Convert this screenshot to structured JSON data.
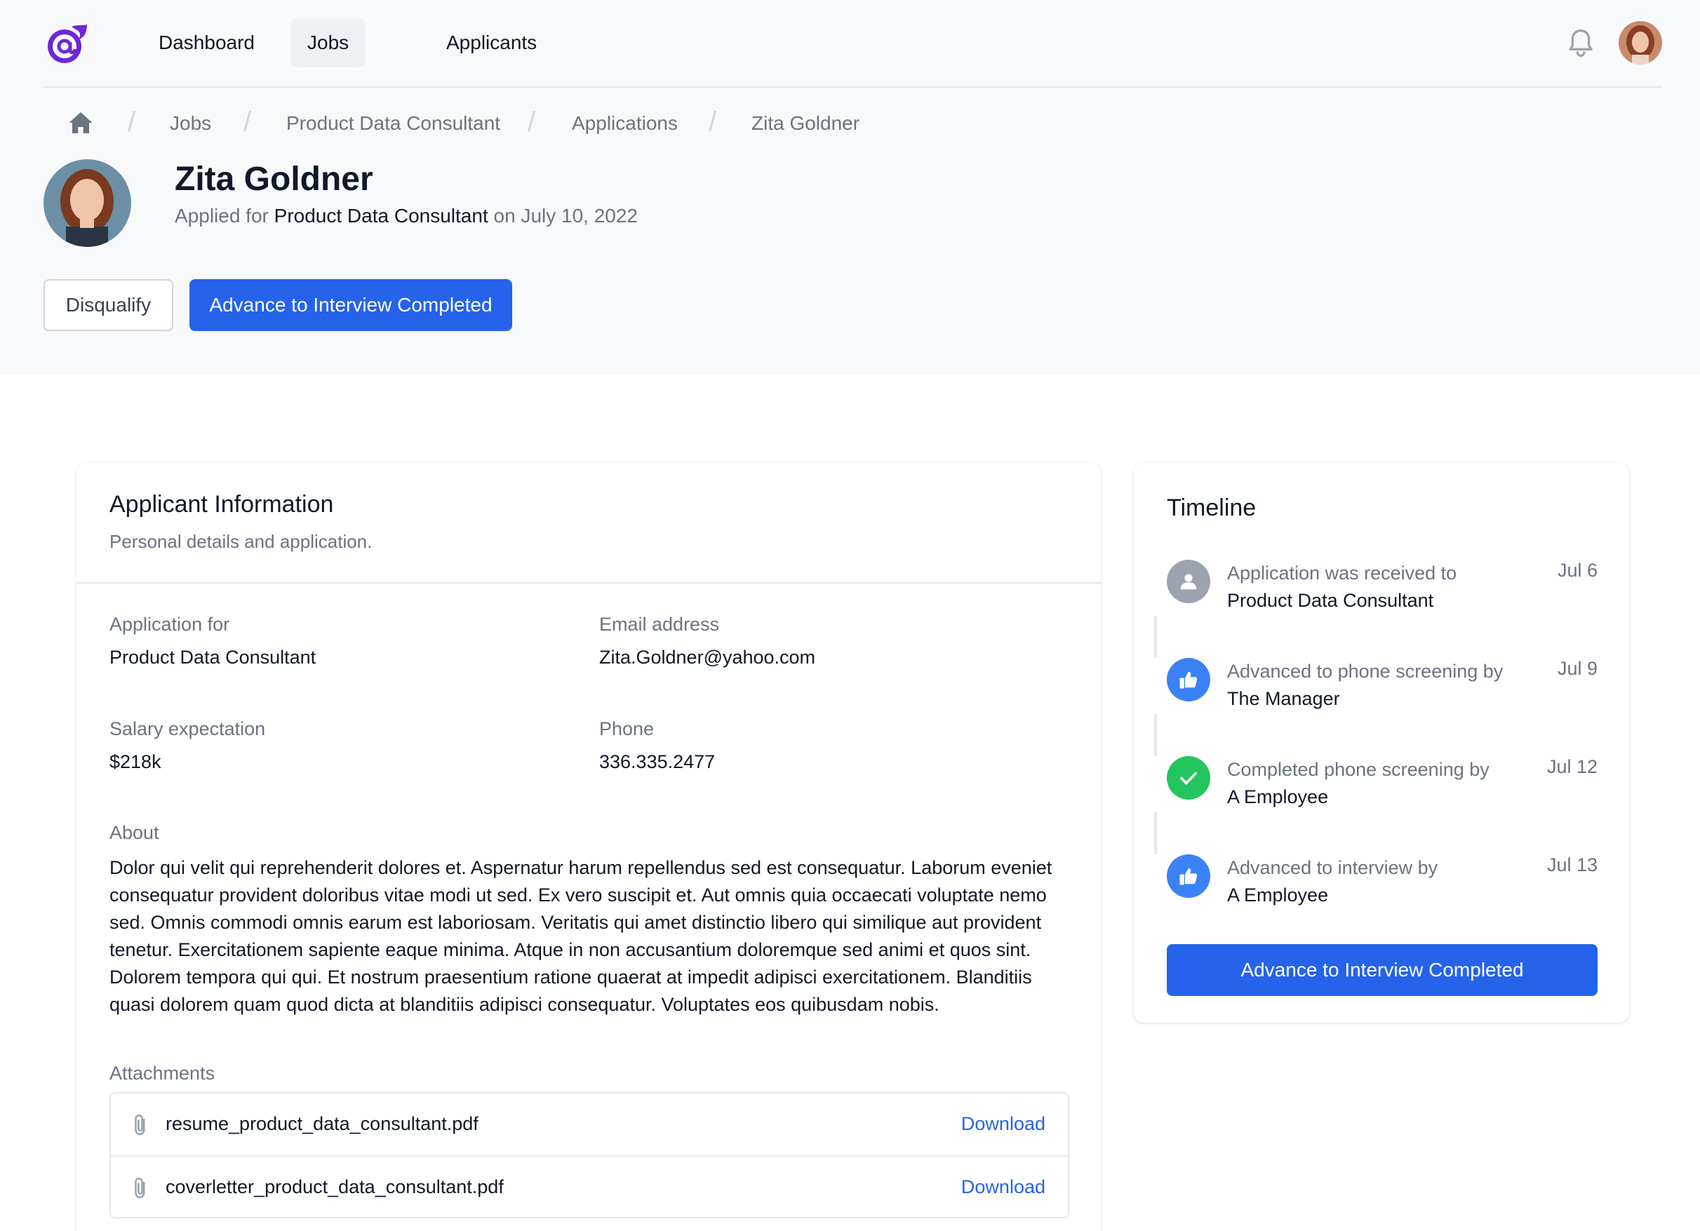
{
  "nav": {
    "items": [
      {
        "label": "Dashboard"
      },
      {
        "label": "Jobs"
      },
      {
        "label": "Applicants"
      }
    ]
  },
  "breadcrumb": {
    "items": [
      "Jobs",
      "Product Data Consultant",
      "Applications",
      "Zita Goldner"
    ]
  },
  "applicant": {
    "name": "Zita Goldner",
    "applied_prefix": "Applied for",
    "applied_job": "Product Data Consultant",
    "applied_on": "on",
    "applied_date": "July 10, 2022"
  },
  "actions": {
    "disqualify": "Disqualify",
    "advance": "Advance to Interview Completed"
  },
  "info": {
    "title": "Applicant Information",
    "subtitle": "Personal details and application.",
    "application_for_label": "Application for",
    "application_for_value": "Product Data Consultant",
    "email_label": "Email address",
    "email_value": "Zita.Goldner@yahoo.com",
    "salary_label": "Salary expectation",
    "salary_value": "$218k",
    "phone_label": "Phone",
    "phone_value": "336.335.2477",
    "about_label": "About",
    "about_text": "Dolor qui velit qui reprehenderit dolores et. Aspernatur harum repellendus sed est consequatur. Laborum eveniet consequatur provident doloribus vitae modi ut sed. Ex vero suscipit et. Aut omnis quia occaecati voluptate nemo sed. Omnis commodi omnis earum est laboriosam. Veritatis qui amet distinctio libero qui similique aut provident tenetur. Exercitationem sapiente eaque minima. Atque in non accusantium doloremque sed animi et quos sint. Dolorem tempora qui qui. Et nostrum praesentium ratione quaerat at impedit adipisci exercitationem. Blanditiis quasi dolorem quam quod dicta at blanditiis adipisci consequatur. Voluptates eos quibusdam nobis.",
    "attachments_label": "Attachments",
    "attachments": [
      {
        "file": "resume_product_data_consultant.pdf",
        "action": "Download"
      },
      {
        "file": "coverletter_product_data_consultant.pdf",
        "action": "Download"
      }
    ]
  },
  "timeline": {
    "title": "Timeline",
    "items": [
      {
        "text": "Application was received to",
        "target": "Product Data Consultant",
        "date": "Jul 6",
        "icon": "user-icon",
        "color": "#9ca3af"
      },
      {
        "text": "Advanced to phone screening by",
        "target": "The Manager",
        "date": "Jul 9",
        "icon": "thumbs-up-icon",
        "color": "#3b82f6"
      },
      {
        "text": "Completed phone screening by",
        "target": "A Employee",
        "date": "Jul 12",
        "icon": "check-icon",
        "color": "#22c55e"
      },
      {
        "text": "Advanced to interview by",
        "target": "A Employee",
        "date": "Jul 13",
        "icon": "thumbs-up-icon",
        "color": "#3b82f6"
      }
    ],
    "button": "Advance to Interview Completed"
  },
  "colors": {
    "primary": "#2563eb",
    "header_bg": "#f8f9fb",
    "logo": "#6d28d9"
  }
}
